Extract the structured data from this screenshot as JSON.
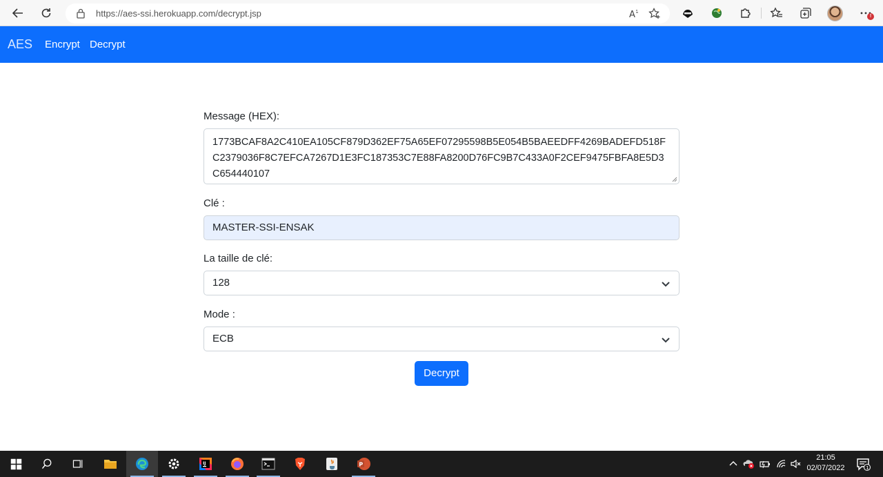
{
  "browser": {
    "url": "https://aes-ssi.herokuapp.com/decrypt.jsp"
  },
  "navbar": {
    "brand": "AES",
    "links": [
      {
        "label": "Encrypt"
      },
      {
        "label": "Decrypt"
      }
    ]
  },
  "form": {
    "message_label": "Message (HEX):",
    "message_value": "1773BCAF8A2C410EA105CF879D362EF75A65EF07295598B5E054B5BAEEDFF4269BADEFD518FC2379036F8C7EFCA7267D1E3FC187353C7E88FA8200D76FC9B7C433A0F2CEF9475FBFA8E5D3C654440107",
    "key_label": "Clé :",
    "key_value": "MASTER-SSI-ENSAK",
    "size_label": "La taille de clé:",
    "size_value": "128",
    "mode_label": "Mode :",
    "mode_value": "ECB",
    "submit_label": "Decrypt"
  },
  "taskbar": {
    "time": "21:05",
    "date": "02/07/2022",
    "notification_count": "1"
  },
  "colors": {
    "primary": "#0d6efd",
    "autofill_bg": "#e8f0fe",
    "taskbar_bg": "#1c1c1c"
  }
}
